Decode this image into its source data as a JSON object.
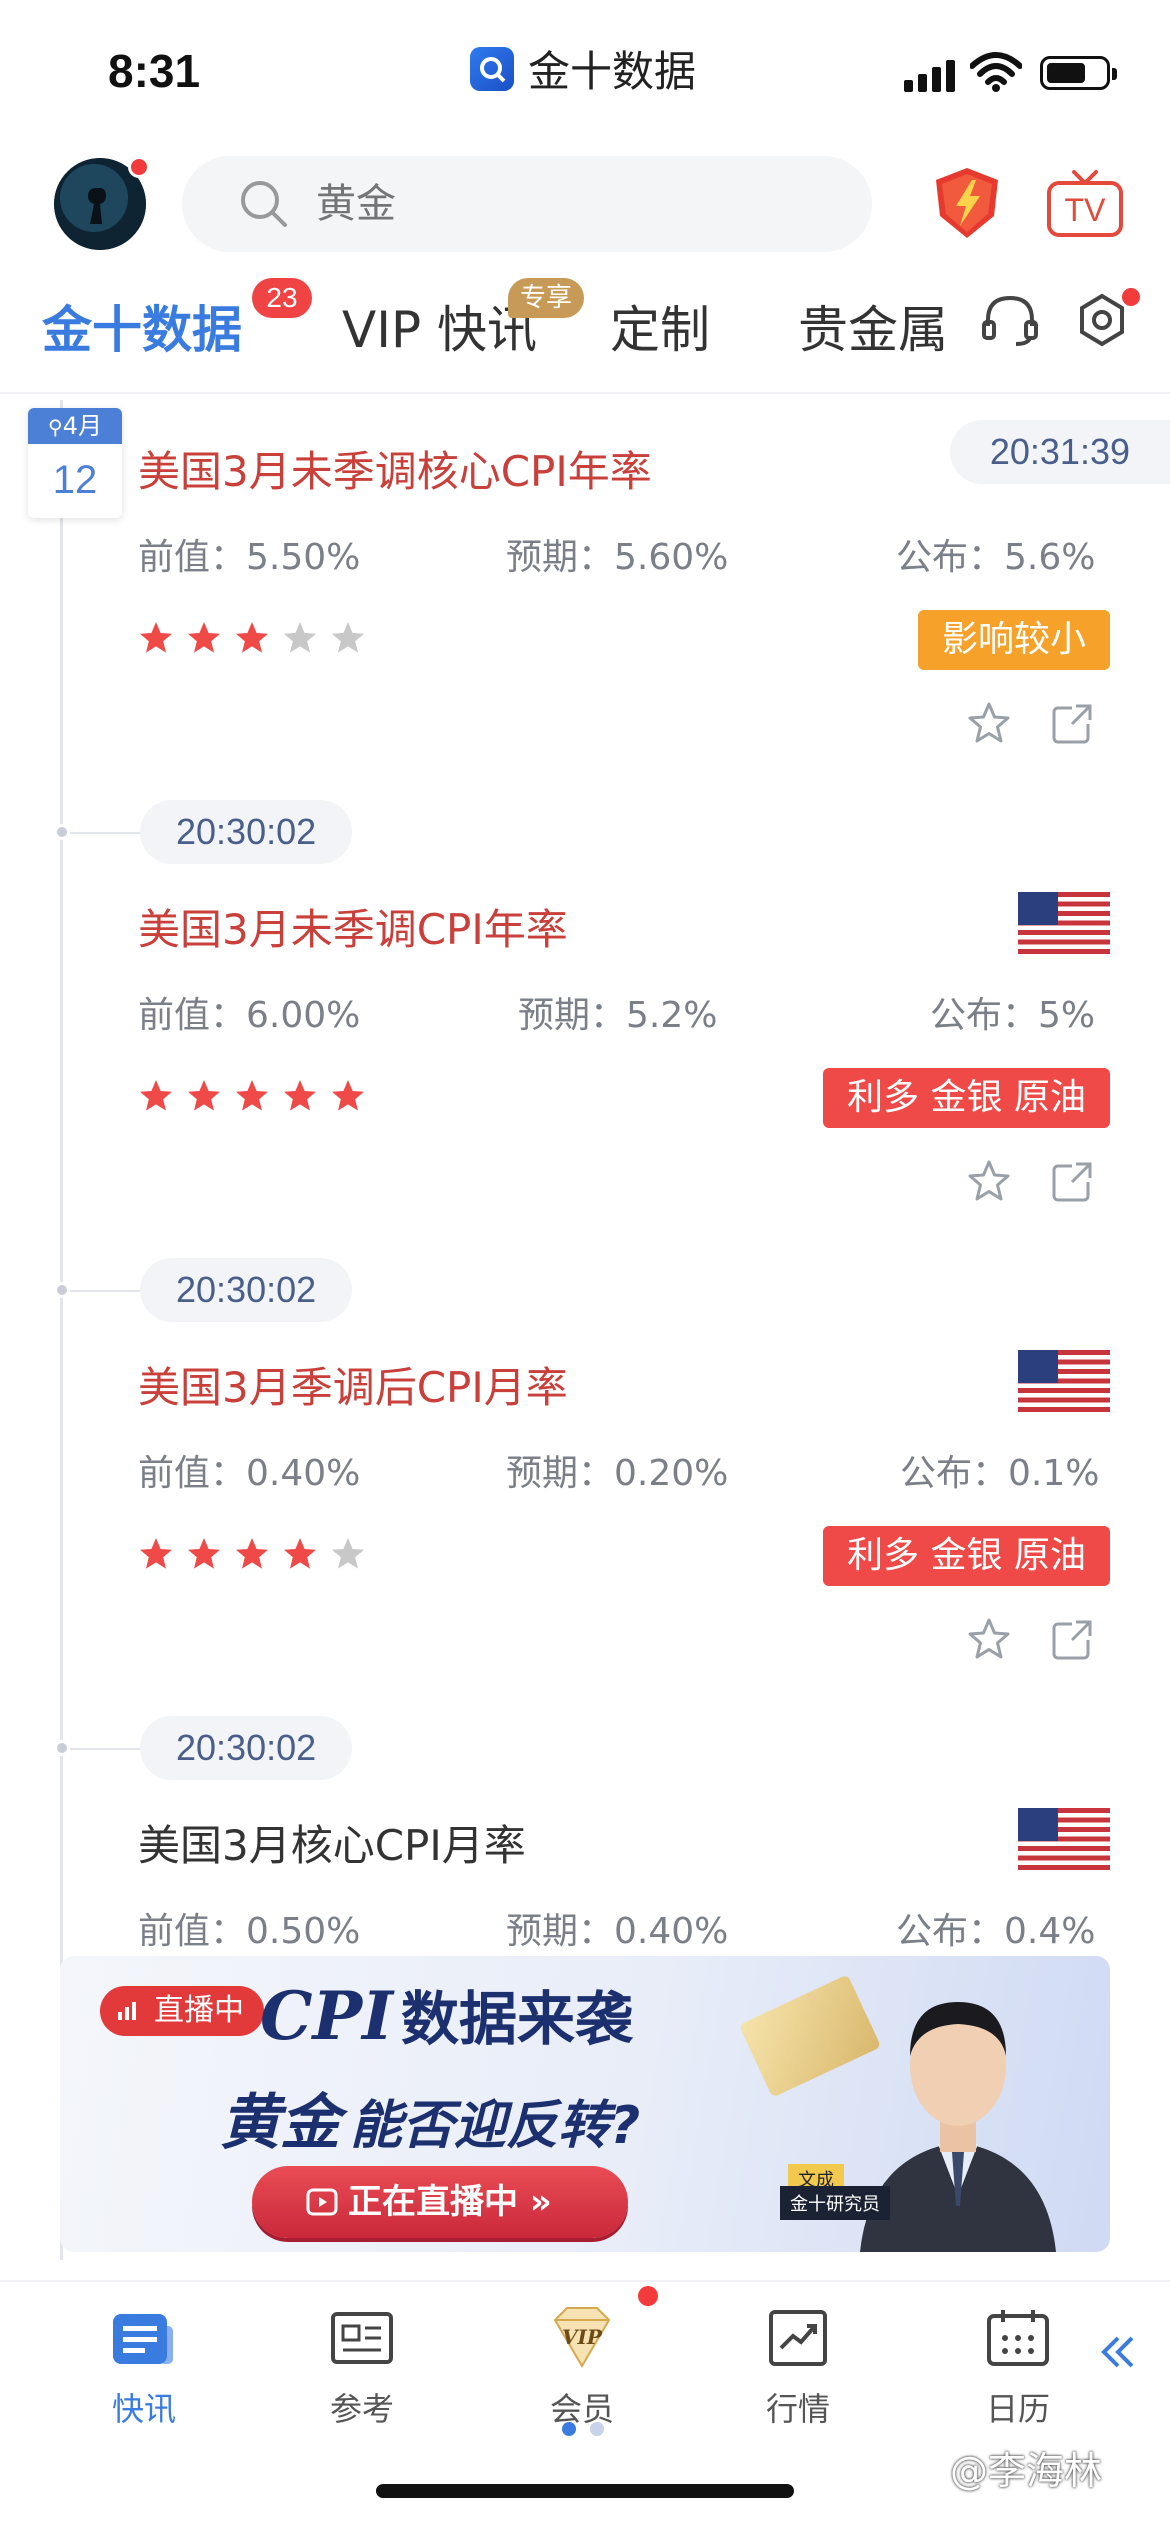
{
  "status_bar": {
    "time": "8:31",
    "app_name": "金十数据"
  },
  "header": {
    "search_placeholder": "黄金"
  },
  "tabs": [
    {
      "label": "金十数据",
      "badge": "23"
    },
    {
      "label": "VIP 快讯",
      "badge": "专享"
    },
    {
      "label": "定制"
    },
    {
      "label": "贵金属"
    }
  ],
  "date_chip": {
    "month": "4月",
    "day": "12"
  },
  "news": [
    {
      "time": "20:31:39",
      "title": "美国3月未季调核心CPI年率",
      "prev_label": "前值：",
      "prev": "5.50%",
      "exp_label": "预期：",
      "exp": "5.60%",
      "act_label": "公布：",
      "act": "5.6%",
      "stars": 3,
      "impact": "影响较小",
      "impact_color": "#f5a12a"
    },
    {
      "time": "20:30:02",
      "title": "美国3月未季调CPI年率",
      "prev_label": "前值：",
      "prev": "6.00%",
      "exp_label": "预期：",
      "exp": "5.2%",
      "act_label": "公布：",
      "act": "5%",
      "stars": 5,
      "impact": "利多 金银 原油",
      "impact_color": "#ef4a48"
    },
    {
      "time": "20:30:02",
      "title": "美国3月季调后CPI月率",
      "prev_label": "前值：",
      "prev": "0.40%",
      "exp_label": "预期：",
      "exp": "0.20%",
      "act_label": "公布：",
      "act": "0.1%",
      "stars": 4,
      "impact": "利多 金银 原油",
      "impact_color": "#ef4a48"
    },
    {
      "time": "20:30:02",
      "title": "美国3月核心CPI月率",
      "prev_label": "前值：",
      "prev": "0.50%",
      "exp_label": "预期：",
      "exp": "0.40%",
      "act_label": "公布：",
      "act": "0.4%"
    }
  ],
  "banner": {
    "live_badge": "直播中",
    "title_cpi": "CPI",
    "title_rest": "数据来袭",
    "title_gold": "黄金",
    "title_question": "能否迎反转?",
    "button": "正在直播中 »",
    "speaker_name": "文成",
    "speaker_title": "金十研究员"
  },
  "bottom_nav": [
    {
      "label": "快讯",
      "icon": "news-flash-icon"
    },
    {
      "label": "参考",
      "icon": "newspaper-icon"
    },
    {
      "label": "会员",
      "icon": "vip-diamond-icon"
    },
    {
      "label": "行情",
      "icon": "trend-chart-icon"
    },
    {
      "label": "日历",
      "icon": "calendar-icon"
    }
  ],
  "watermark": "@李海林",
  "colors": {
    "accent": "#3a7be0",
    "title_red": "#c9403b",
    "star_red": "#ef4a48",
    "star_gray": "#c8c8c8"
  }
}
